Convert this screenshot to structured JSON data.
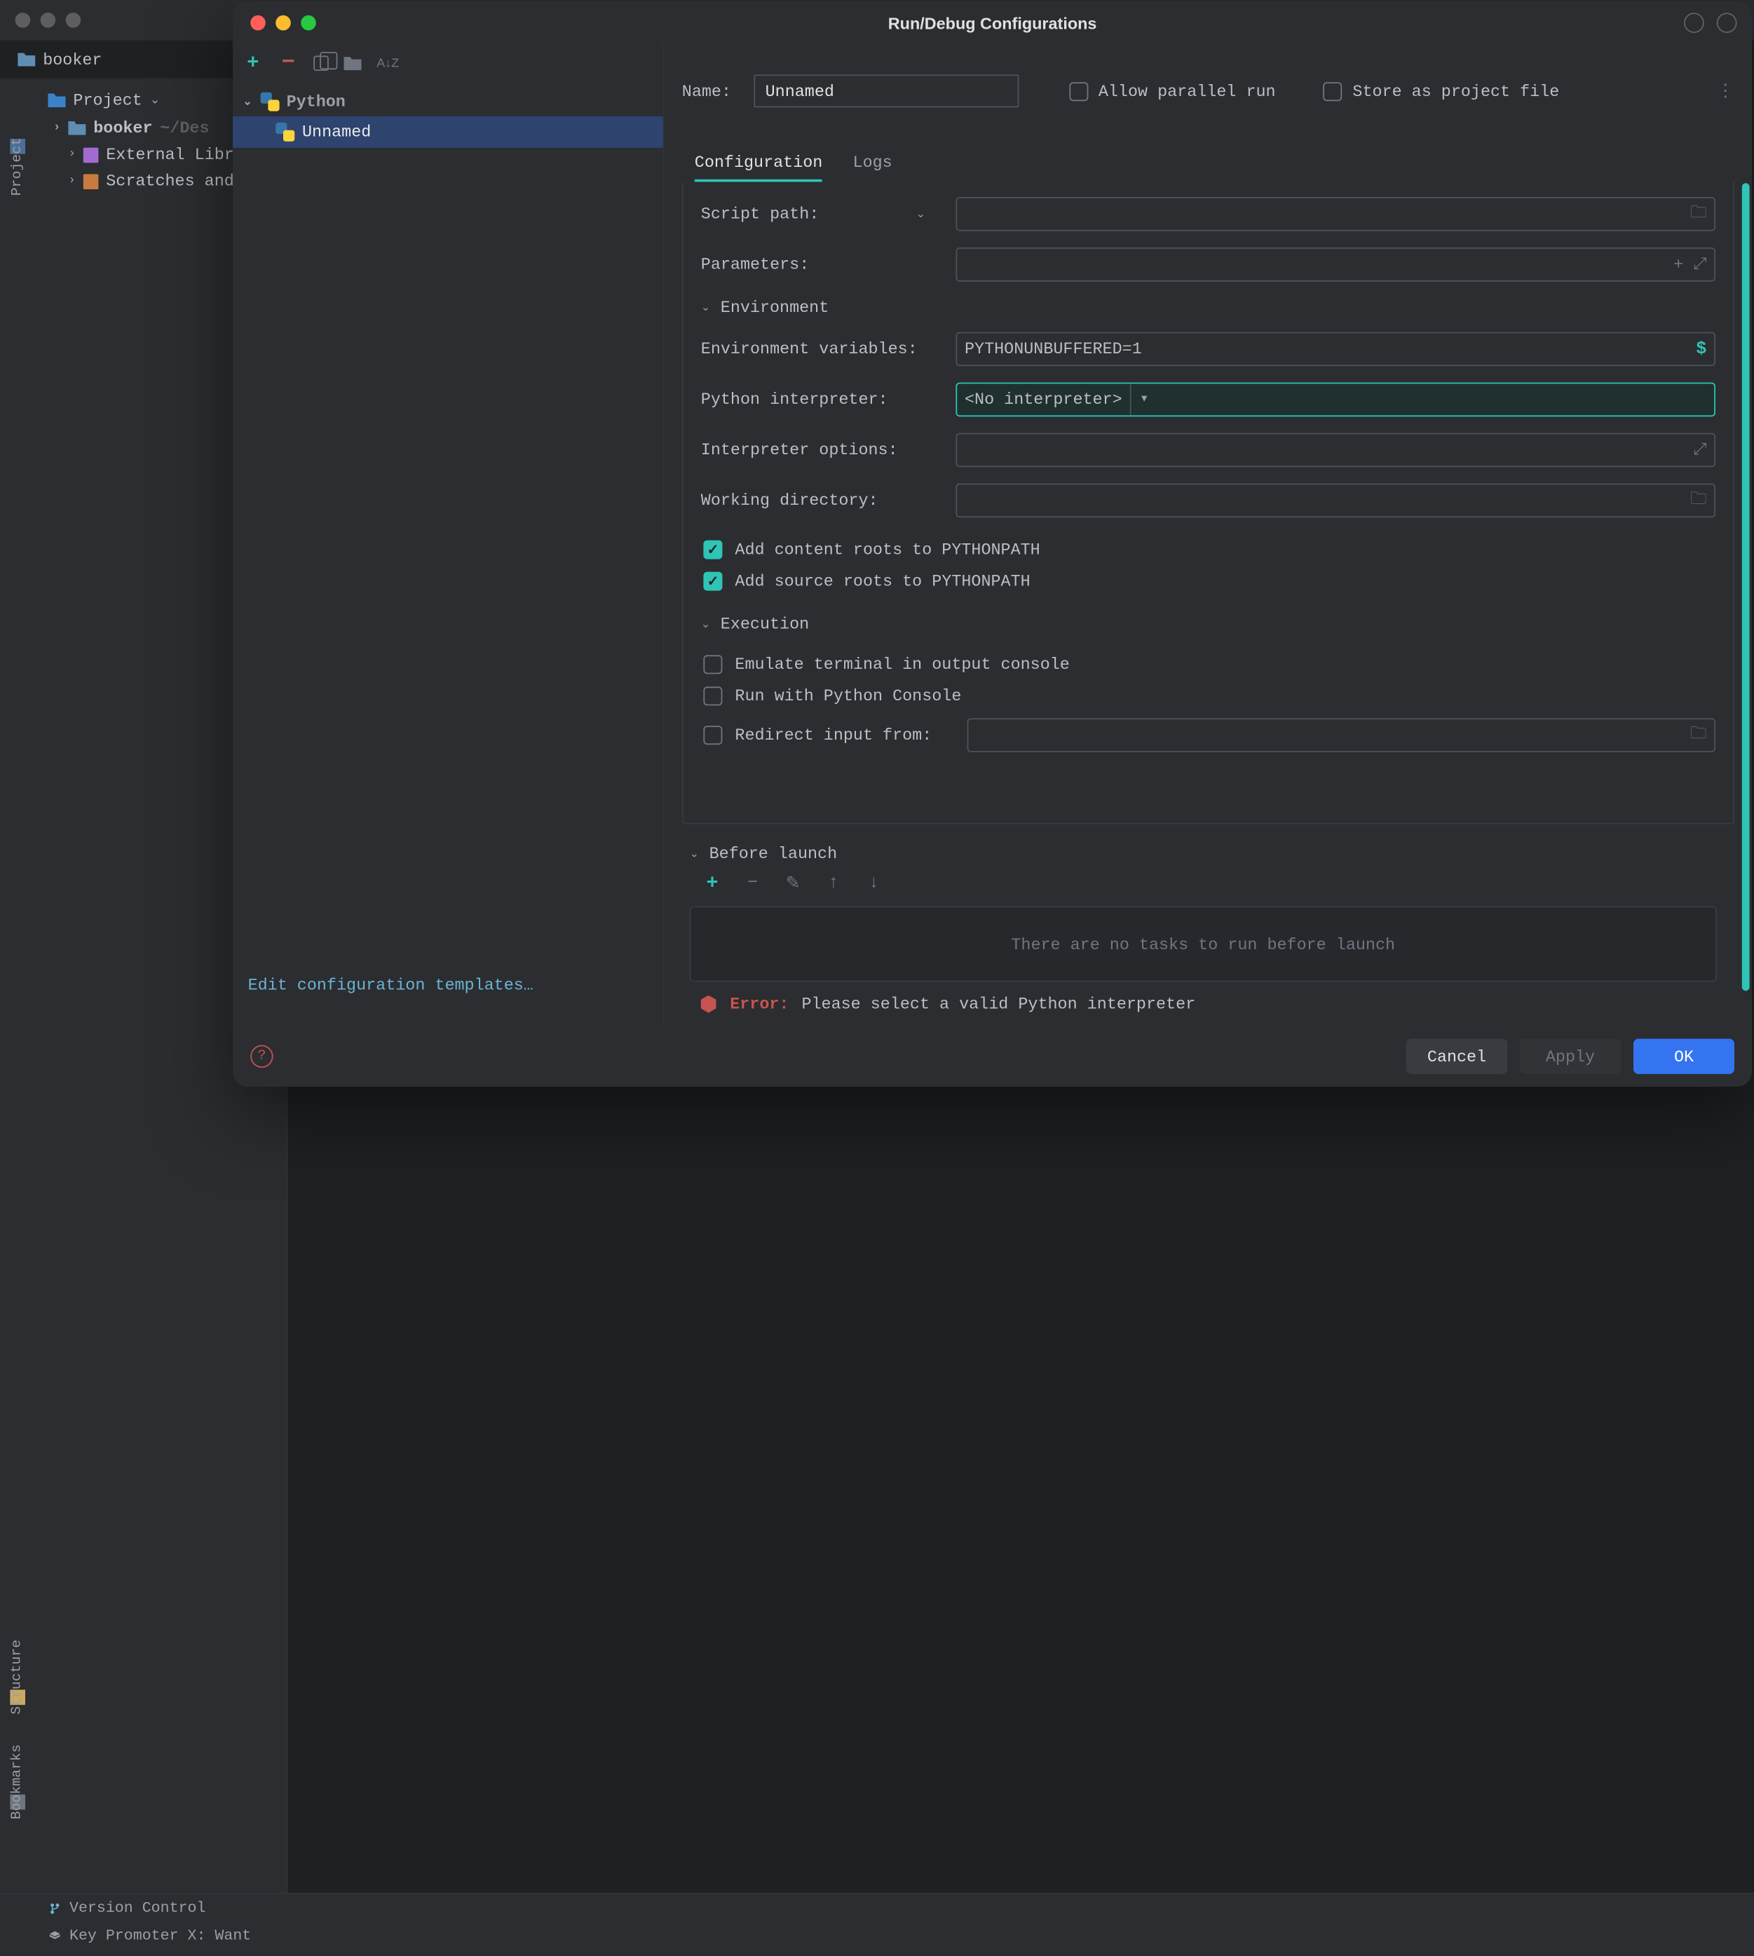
{
  "ide": {
    "project_name": "booker",
    "project_panel_label": "Project",
    "tree": {
      "root": "booker",
      "root_path": "~/Des",
      "external": "External Libr",
      "scratches": "Scratches and"
    },
    "rail": {
      "project": "Project",
      "structure": "Structure",
      "bookmarks": "Bookmarks"
    },
    "status": {
      "vc": "Version Control",
      "kp": "Key Promoter X: Want"
    }
  },
  "dialog": {
    "title": "Run/Debug Configurations",
    "toolbar": {
      "az": "A↓Z"
    },
    "tree": {
      "group": "Python",
      "item": "Unnamed"
    },
    "edit_templates": "Edit configuration templates…",
    "name_label": "Name:",
    "name_value": "Unnamed",
    "parallel_label": "Allow parallel run",
    "store_label": "Store as project file",
    "tabs": {
      "config": "Configuration",
      "logs": "Logs"
    },
    "fields": {
      "script_path": "Script path:",
      "parameters": "Parameters:",
      "environment": "Environment",
      "env_vars_label": "Environment variables:",
      "env_vars_value": "PYTHONUNBUFFERED=1",
      "interpreter_label": "Python interpreter:",
      "interpreter_value": "<No interpreter>",
      "interp_opts": "Interpreter options:",
      "working_dir": "Working directory:",
      "add_content": "Add content roots to PYTHONPATH",
      "add_source": "Add source roots to PYTHONPATH",
      "execution": "Execution",
      "emulate": "Emulate terminal in output console",
      "run_console": "Run with Python Console",
      "redirect": "Redirect input from:"
    },
    "before_launch": {
      "label": "Before launch",
      "empty": "There are no tasks to run before launch"
    },
    "error": {
      "prefix": "Error:",
      "message": "Please select a valid Python interpreter"
    },
    "buttons": {
      "cancel": "Cancel",
      "apply": "Apply",
      "ok": "OK"
    }
  }
}
